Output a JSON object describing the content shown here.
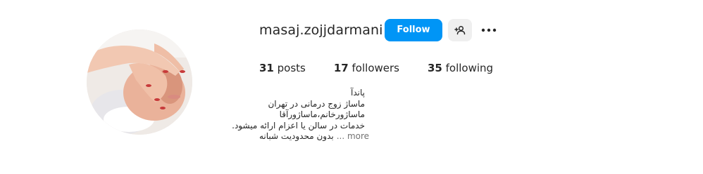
{
  "profile": {
    "username": "masaj.zojjdarmani",
    "follow_label": "Follow",
    "stats": {
      "posts_count": "31",
      "posts_label": "posts",
      "followers_count": "17",
      "followers_label": "followers",
      "following_count": "35",
      "following_label": "following"
    },
    "bio": {
      "line1": "پاندآ",
      "line2": "ماساژ زوج درمانی در تهران",
      "line3": "ماساژورخانم،ماساژورآقا",
      "line4": "خدمات در سالن یا اعزام ارائه میشود.",
      "line5": "بدون محدودیت شبانه",
      "more_label": "... more"
    }
  },
  "colors": {
    "accent": "#0095f6",
    "secondary_button": "#efefef",
    "muted_text": "#737373"
  },
  "icons": {
    "suggest": "add-person-icon",
    "options": "more-options-icon"
  }
}
